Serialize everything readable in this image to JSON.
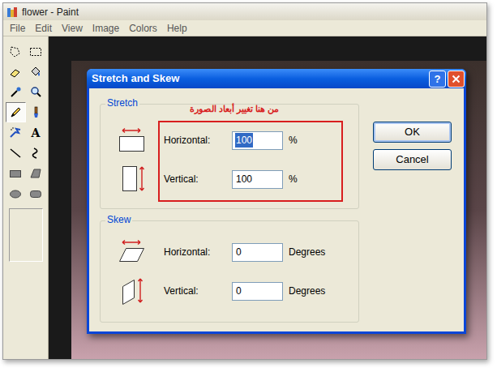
{
  "window": {
    "title": "flower - Paint"
  },
  "menu": [
    "File",
    "Edit",
    "View",
    "Image",
    "Colors",
    "Help"
  ],
  "tools": [
    {
      "kind": "free-select",
      "selected": false
    },
    {
      "kind": "rect-select",
      "selected": false
    },
    {
      "kind": "eraser",
      "selected": false
    },
    {
      "kind": "fill",
      "selected": false
    },
    {
      "kind": "picker",
      "selected": false
    },
    {
      "kind": "magnifier",
      "selected": false
    },
    {
      "kind": "pencil",
      "selected": true
    },
    {
      "kind": "brush",
      "selected": false
    },
    {
      "kind": "airbrush",
      "selected": false
    },
    {
      "kind": "text",
      "selected": false,
      "glyph": "A"
    },
    {
      "kind": "line",
      "selected": false
    },
    {
      "kind": "curve",
      "selected": false
    },
    {
      "kind": "rectangle",
      "selected": false
    },
    {
      "kind": "polygon",
      "selected": false
    },
    {
      "kind": "ellipse",
      "selected": false
    },
    {
      "kind": "rounded",
      "selected": false
    }
  ],
  "dialog": {
    "title": "Stretch and Skew",
    "help_button": "?",
    "annotation": "من هنا تغيير أبعاد الصورة",
    "stretch": {
      "label": "Stretch",
      "fields": [
        {
          "kind": "horizontal",
          "label": "Horizontal:",
          "value": "100",
          "unit": "%",
          "selected": true
        },
        {
          "kind": "vertical",
          "label": "Vertical:",
          "value": "100",
          "unit": "%",
          "selected": false
        }
      ]
    },
    "skew": {
      "label": "Skew",
      "fields": [
        {
          "kind": "horizontal",
          "label": "Horizontal:",
          "value": "0",
          "unit": "Degrees",
          "selected": false
        },
        {
          "kind": "vertical",
          "label": "Vertical:",
          "value": "0",
          "unit": "Degrees",
          "selected": false
        }
      ]
    },
    "buttons": [
      {
        "label": "OK",
        "default": true
      },
      {
        "label": "Cancel",
        "default": false
      }
    ]
  }
}
